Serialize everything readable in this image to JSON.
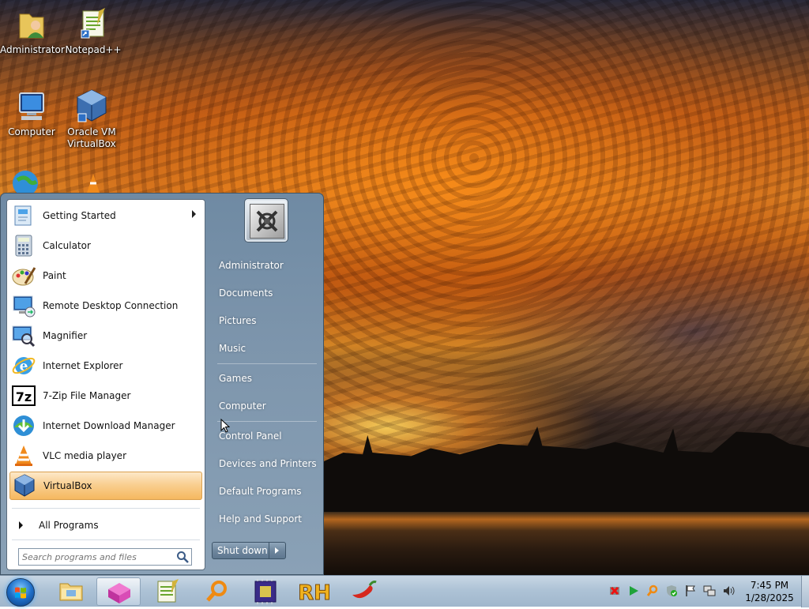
{
  "desktop": {
    "icons": [
      {
        "label": "Administrator",
        "icon": "user-folder-icon"
      },
      {
        "label": "Notepad++",
        "icon": "notepadpp-icon"
      },
      {
        "label": "Computer",
        "icon": "computer-icon"
      },
      {
        "label": "Oracle VM VirtualBox",
        "icon": "virtualbox-icon"
      }
    ]
  },
  "start_menu": {
    "programs": [
      {
        "label": "Getting Started",
        "icon": "getting-started-icon",
        "has_submenu": true
      },
      {
        "label": "Calculator",
        "icon": "calculator-icon"
      },
      {
        "label": "Paint",
        "icon": "paint-icon"
      },
      {
        "label": "Remote Desktop Connection",
        "icon": "remote-desktop-icon"
      },
      {
        "label": "Magnifier",
        "icon": "magnifier-icon"
      },
      {
        "label": "Internet Explorer",
        "icon": "internet-explorer-icon"
      },
      {
        "label": "7-Zip File Manager",
        "icon": "7zip-icon"
      },
      {
        "label": "Internet Download Manager",
        "icon": "idm-icon"
      },
      {
        "label": "VLC media player",
        "icon": "vlc-icon"
      },
      {
        "label": "VirtualBox",
        "icon": "virtualbox-icon",
        "selected": true
      }
    ],
    "all_programs": "All Programs",
    "search_placeholder": "Search programs and files",
    "right_items": [
      "Administrator",
      "Documents",
      "Pictures",
      "Music",
      "Games",
      "Computer",
      "Control Panel",
      "Devices and Printers",
      "Default Programs",
      "Help and Support"
    ],
    "shutdown_label": "Shut down"
  },
  "taskbar": {
    "pinned": [
      {
        "name": "explorer",
        "icon": "folder-icon"
      },
      {
        "name": "virtualbox-manager",
        "icon": "pink-cube-icon",
        "active": true
      },
      {
        "name": "notepadpp",
        "icon": "notepadpp-icon"
      },
      {
        "name": "search-tool",
        "icon": "magnifier-orange-icon"
      },
      {
        "name": "cpu-tool",
        "icon": "chip-icon"
      },
      {
        "name": "resource-hacker",
        "icon": "rh-icon"
      },
      {
        "name": "pepper-app",
        "icon": "chili-icon"
      }
    ],
    "tray_icons": [
      "red-x-icon",
      "green-play-icon",
      "orange-search-icon",
      "shield-check-icon",
      "flag-icon",
      "network-icon",
      "speaker-icon"
    ],
    "clock_time": "7:45 PM",
    "clock_date": "1/28/2025"
  },
  "colors": {
    "selected_item": "#f9cf91",
    "taskbar": "#aec3d6",
    "start_right_pane": "#7d95ac"
  }
}
